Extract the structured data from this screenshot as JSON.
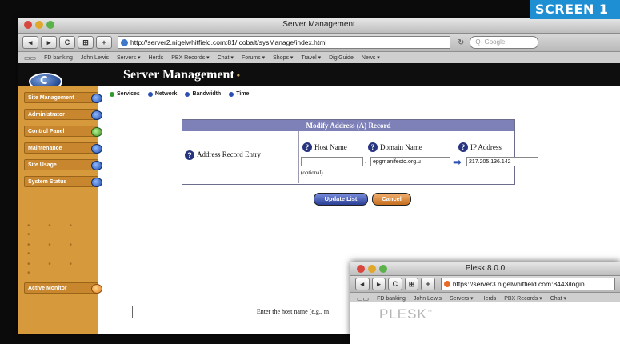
{
  "screen_label": "SCREEN 1",
  "window": {
    "title": "Server Management",
    "url": "http://server2.nigelwhitfield.com:81/.cobalt/sysManage/index.html",
    "search_placeholder": "Q- Google",
    "bookmarks": [
      "FD banking",
      "John Lewis",
      "Servers ▾",
      "Herds",
      "PBX Records ▾",
      "Chat ▾",
      "Forums ▾",
      "Shops ▾",
      "Travel ▾",
      "DigiGuide",
      "News ▾"
    ]
  },
  "page": {
    "title": "Server Management",
    "tabs": [
      "Services",
      "Network",
      "Bandwidth",
      "Time"
    ],
    "sidebar": [
      "Site Management",
      "Administrator",
      "Control Panel",
      "Maintenance",
      "Site Usage",
      "System Status"
    ],
    "active_monitor": "Active Monitor",
    "form": {
      "heading": "Modify Address (A) Record",
      "row_label": "Address Record Entry",
      "col_host": "Host Name",
      "col_domain": "Domain Name",
      "col_ip": "IP Address",
      "host_value": "",
      "domain_value": "epgmanifesto.org.u",
      "ip_value": "217.205.136.142",
      "optional": "(optional)"
    },
    "buttons": {
      "update": "Update List",
      "cancel": "Cancel"
    },
    "status_text": "Enter the host name (e.g., m"
  },
  "window2": {
    "title": "Plesk 8.0.0",
    "url": "https://server3.nigelwhitfield.com:8443/login",
    "bookmarks": [
      "FD banking",
      "John Lewis",
      "Servers ▾",
      "Herds",
      "PBX Records ▾",
      "Chat ▾"
    ],
    "logo": "PLESK"
  },
  "colors": {
    "sidebar": "#d69a3c",
    "form_header": "#7e80b8",
    "label_blue": "#1f8fd4"
  }
}
